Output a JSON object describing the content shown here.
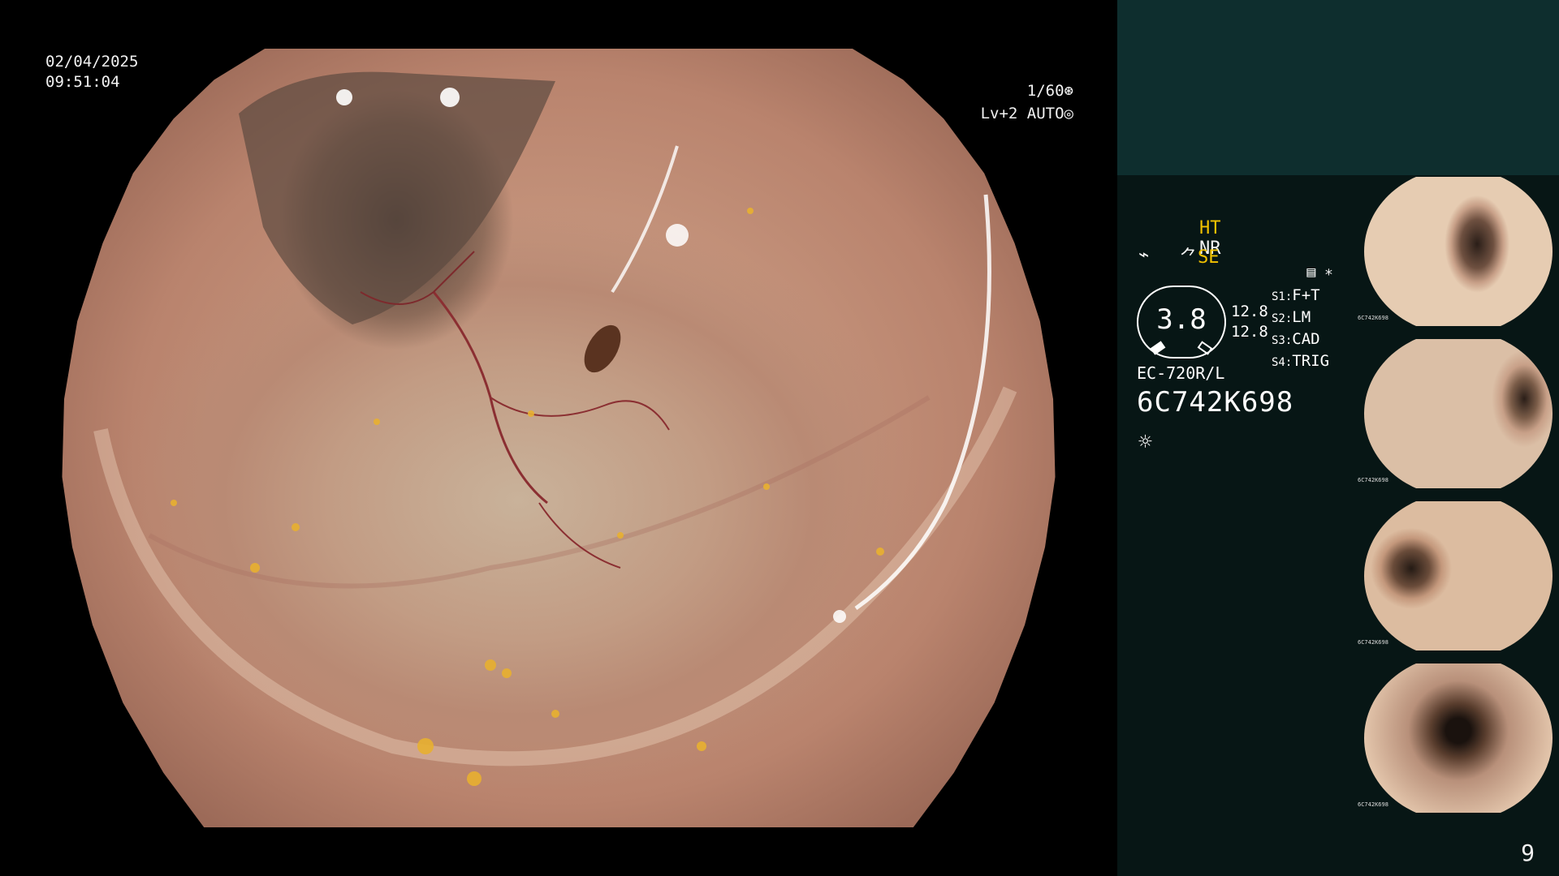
{
  "overlay": {
    "date": "02/04/2025",
    "time": "09:51:04",
    "shutter": "1/60",
    "level": "Lv+2 AUTO"
  },
  "sidebar": {
    "mode_ht": "HT",
    "mode_nr": "NR",
    "se_label": "SE",
    "gauge_value": "3.8",
    "gauge_read_1": "12.8",
    "gauge_read_2": "12.8",
    "settings": [
      {
        "slot": "S1:",
        "value": "F+T"
      },
      {
        "slot": "S2:",
        "value": "LM"
      },
      {
        "slot": "S3:",
        "value": "CAD"
      },
      {
        "slot": "S4:",
        "value": "TRIG"
      }
    ],
    "scope_model": "EC-720R/L",
    "serial": "6C742K698",
    "thumbnail_serial": "6C742K698"
  },
  "page_number": "9",
  "colors": {
    "sidebar_bg": "#071615",
    "sidebar_top_bg": "#0e2e2e",
    "highlight_yellow": "#f2c200"
  }
}
